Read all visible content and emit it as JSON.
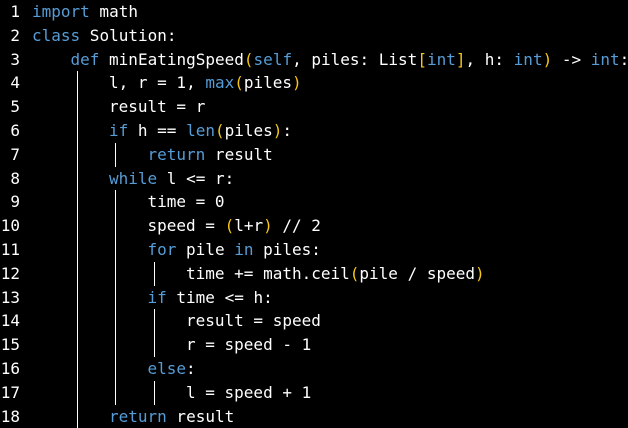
{
  "colors": {
    "background": "#000000",
    "text": "#ffffff",
    "keyword": "#569cd6",
    "bracket": "#f5c518"
  },
  "editor": {
    "lines": [
      {
        "number": "1",
        "indent": 0,
        "tokens": [
          {
            "t": "import",
            "c": "kw"
          },
          {
            "t": " math",
            "c": "plain"
          }
        ]
      },
      {
        "number": "2",
        "indent": 0,
        "tokens": [
          {
            "t": "class",
            "c": "kw"
          },
          {
            "t": " Solution:",
            "c": "plain"
          }
        ]
      },
      {
        "number": "3",
        "indent": 1,
        "tokens": [
          {
            "t": "def",
            "c": "kw"
          },
          {
            "t": " minEatingSpeed",
            "c": "plain"
          },
          {
            "t": "(",
            "c": "paren"
          },
          {
            "t": "self",
            "c": "kw"
          },
          {
            "t": ", piles: List",
            "c": "plain"
          },
          {
            "t": "[",
            "c": "paren"
          },
          {
            "t": "int",
            "c": "type"
          },
          {
            "t": "]",
            "c": "paren"
          },
          {
            "t": ", h: ",
            "c": "plain"
          },
          {
            "t": "int",
            "c": "type"
          },
          {
            "t": ")",
            "c": "paren"
          },
          {
            "t": " -> ",
            "c": "plain"
          },
          {
            "t": "int",
            "c": "type"
          },
          {
            "t": ":",
            "c": "plain"
          }
        ]
      },
      {
        "number": "4",
        "indent": 2,
        "tokens": [
          {
            "t": "l, r = 1, ",
            "c": "plain"
          },
          {
            "t": "max",
            "c": "kw"
          },
          {
            "t": "(",
            "c": "paren"
          },
          {
            "t": "piles",
            "c": "plain"
          },
          {
            "t": ")",
            "c": "paren"
          }
        ]
      },
      {
        "number": "5",
        "indent": 2,
        "tokens": [
          {
            "t": "result = r",
            "c": "plain"
          }
        ]
      },
      {
        "number": "6",
        "indent": 2,
        "tokens": [
          {
            "t": "if",
            "c": "kw"
          },
          {
            "t": " h == ",
            "c": "plain"
          },
          {
            "t": "len",
            "c": "kw"
          },
          {
            "t": "(",
            "c": "paren"
          },
          {
            "t": "piles",
            "c": "plain"
          },
          {
            "t": ")",
            "c": "paren"
          },
          {
            "t": ":",
            "c": "plain"
          }
        ]
      },
      {
        "number": "7",
        "indent": 3,
        "tokens": [
          {
            "t": "return",
            "c": "kw"
          },
          {
            "t": " result",
            "c": "plain"
          }
        ]
      },
      {
        "number": "8",
        "indent": 2,
        "tokens": [
          {
            "t": "while",
            "c": "kw"
          },
          {
            "t": " l <= r:",
            "c": "plain"
          }
        ]
      },
      {
        "number": "9",
        "indent": 3,
        "tokens": [
          {
            "t": "time = 0",
            "c": "plain"
          }
        ]
      },
      {
        "number": "10",
        "indent": 3,
        "tokens": [
          {
            "t": "speed = ",
            "c": "plain"
          },
          {
            "t": "(",
            "c": "paren"
          },
          {
            "t": "l+r",
            "c": "plain"
          },
          {
            "t": ")",
            "c": "paren"
          },
          {
            "t": " // 2",
            "c": "plain"
          }
        ]
      },
      {
        "number": "11",
        "indent": 3,
        "tokens": [
          {
            "t": "for",
            "c": "kw"
          },
          {
            "t": " pile ",
            "c": "plain"
          },
          {
            "t": "in",
            "c": "kw"
          },
          {
            "t": " piles:",
            "c": "plain"
          }
        ]
      },
      {
        "number": "12",
        "indent": 4,
        "tokens": [
          {
            "t": "time += math.ceil",
            "c": "plain"
          },
          {
            "t": "(",
            "c": "paren"
          },
          {
            "t": "pile / speed",
            "c": "plain"
          },
          {
            "t": ")",
            "c": "paren"
          }
        ]
      },
      {
        "number": "13",
        "indent": 3,
        "tokens": [
          {
            "t": "if",
            "c": "kw"
          },
          {
            "t": " time <= h:",
            "c": "plain"
          }
        ]
      },
      {
        "number": "14",
        "indent": 4,
        "tokens": [
          {
            "t": "result = speed",
            "c": "plain"
          }
        ]
      },
      {
        "number": "15",
        "indent": 4,
        "tokens": [
          {
            "t": "r = speed - 1",
            "c": "plain"
          }
        ]
      },
      {
        "number": "16",
        "indent": 3,
        "tokens": [
          {
            "t": "else",
            "c": "kw"
          },
          {
            "t": ":",
            "c": "plain"
          }
        ]
      },
      {
        "number": "17",
        "indent": 4,
        "tokens": [
          {
            "t": "l = speed + 1",
            "c": "plain"
          }
        ]
      },
      {
        "number": "18",
        "indent": 2,
        "tokens": [
          {
            "t": "return",
            "c": "kw"
          },
          {
            "t": " result",
            "c": "plain"
          }
        ]
      }
    ]
  }
}
